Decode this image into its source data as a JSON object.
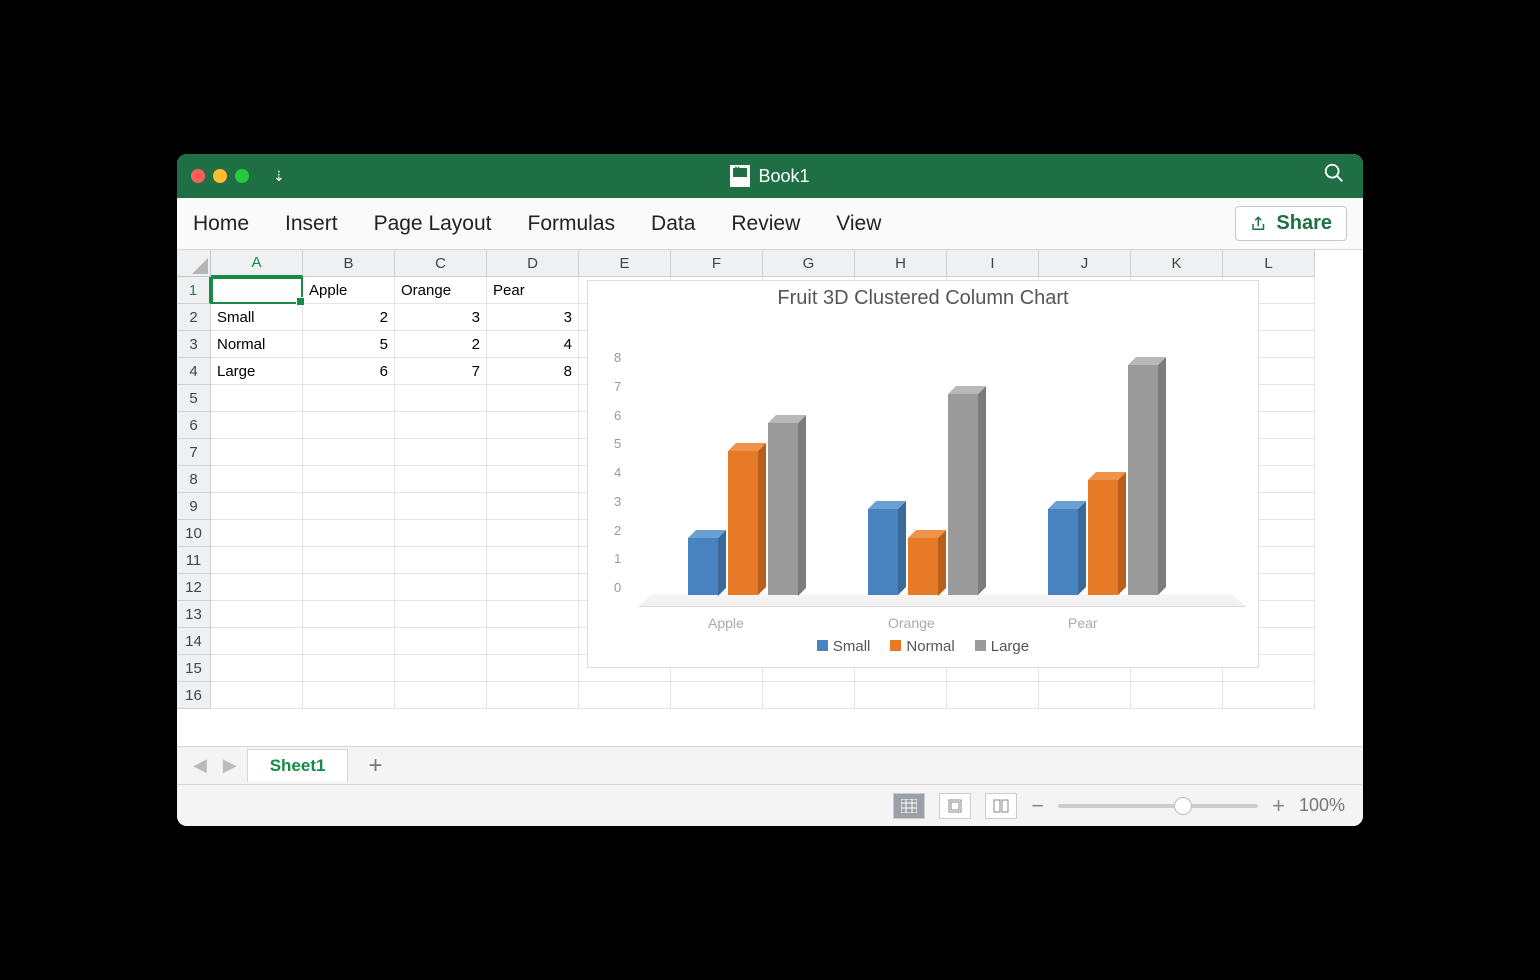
{
  "window": {
    "title": "Book1"
  },
  "ribbon": {
    "tabs": [
      "Home",
      "Insert",
      "Page Layout",
      "Formulas",
      "Data",
      "Review",
      "View"
    ],
    "share": "Share"
  },
  "columns": [
    "A",
    "B",
    "C",
    "D",
    "E",
    "F",
    "G",
    "H",
    "I",
    "J",
    "K",
    "L"
  ],
  "rows": [
    "1",
    "2",
    "3",
    "4",
    "5",
    "6",
    "7",
    "8",
    "9",
    "10",
    "11",
    "12",
    "13",
    "14",
    "15",
    "16"
  ],
  "cells": {
    "B1": "Apple",
    "C1": "Orange",
    "D1": "Pear",
    "A2": "Small",
    "B2": "2",
    "C2": "3",
    "D2": "3",
    "A3": "Normal",
    "B3": "5",
    "C3": "2",
    "D3": "4",
    "A4": "Large",
    "B4": "6",
    "C4": "7",
    "D4": "8"
  },
  "selected": {
    "col": "A",
    "row": "1"
  },
  "sheet_tab": "Sheet1",
  "zoom": "100%",
  "chart_data": {
    "type": "bar",
    "title": "Fruit 3D Clustered Column Chart",
    "categories": [
      "Apple",
      "Orange",
      "Pear"
    ],
    "series": [
      {
        "name": "Small",
        "values": [
          2,
          3,
          3
        ],
        "color": "#4983bf"
      },
      {
        "name": "Normal",
        "values": [
          5,
          2,
          4
        ],
        "color": "#e67a26"
      },
      {
        "name": "Large",
        "values": [
          6,
          7,
          8
        ],
        "color": "#9b9b9b"
      }
    ],
    "y_ticks": [
      0,
      1,
      2,
      3,
      4,
      5,
      6,
      7,
      8
    ],
    "ylim": [
      0,
      8
    ]
  }
}
